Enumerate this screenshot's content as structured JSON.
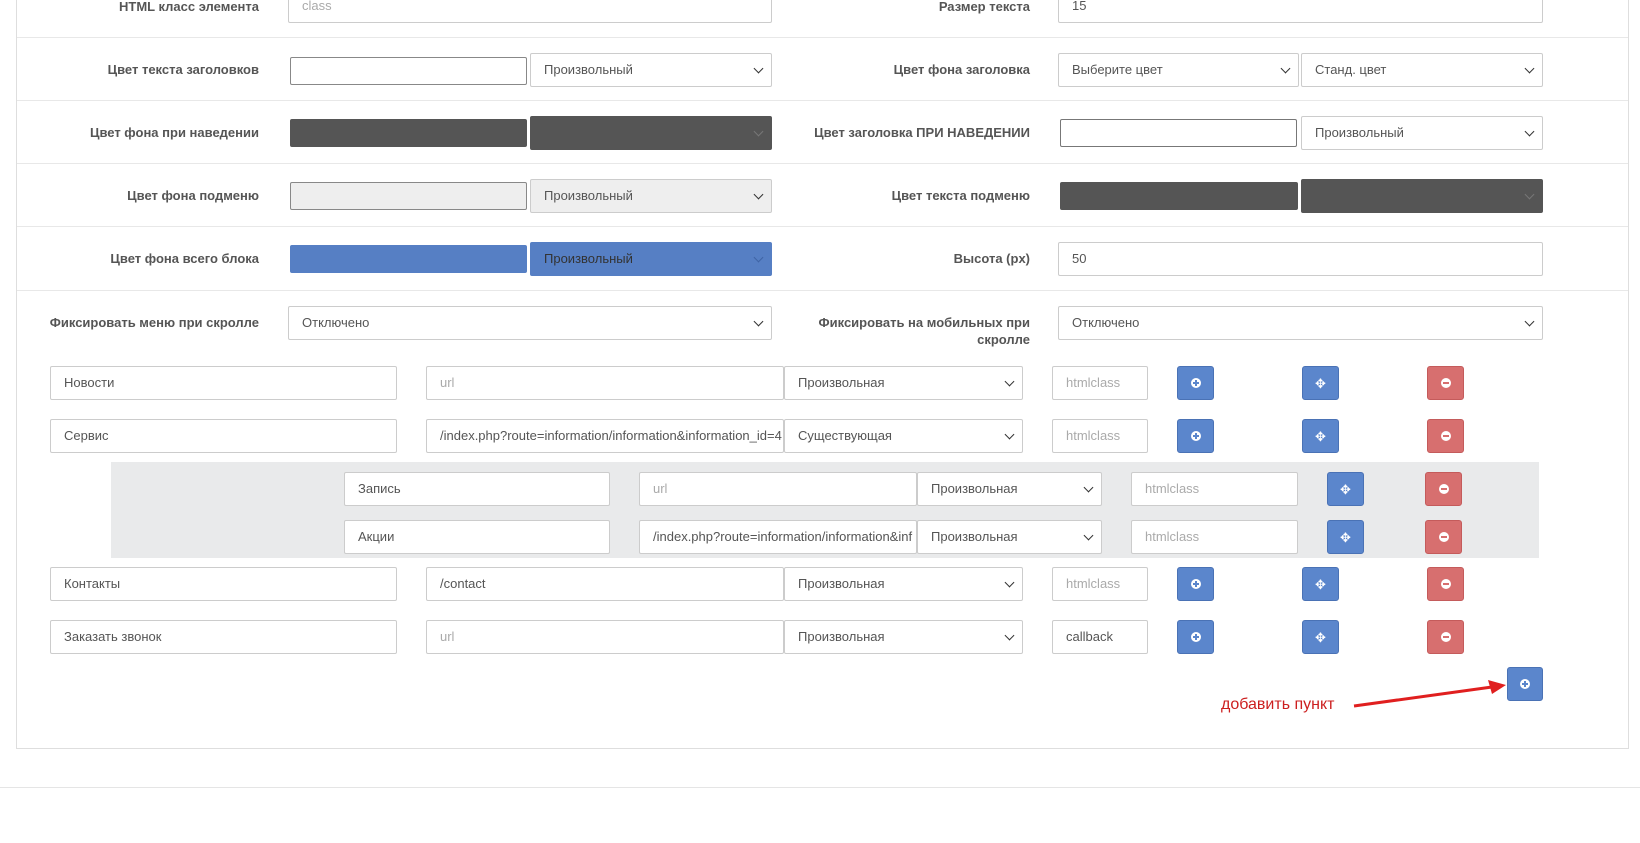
{
  "settings": {
    "html_class_label": "HTML класс элемента",
    "html_class_placeholder": "class",
    "text_size_label": "Размер текста",
    "text_size_value": "15",
    "title_text_color_label": "Цвет текста заголовков",
    "title_text_color_select": "Произвольный",
    "title_bg_color_label": "Цвет фона заголовка",
    "title_bg_color_select": "Выберите цвет",
    "title_bg_std_select": "Станд. цвет",
    "hover_bg_color_label": "Цвет фона при наведении",
    "hover_title_color_label": "Цвет заголовка ПРИ НАВЕДЕНИИ",
    "hover_title_color_select": "Произвольный",
    "submenu_bg_label": "Цвет фона подменю",
    "submenu_bg_select": "Произвольный",
    "submenu_text_label": "Цвет текста подменю",
    "block_bg_label": "Цвет фона всего блока",
    "block_bg_select": "Произвольный",
    "height_label": "Высота (px)",
    "height_value": "50",
    "fix_scroll_label": "Фиксировать меню при скролле",
    "fix_scroll_select": "Отключено",
    "fix_mobile_label": "Фиксировать на мобильных при скролле",
    "fix_mobile_select": "Отключено"
  },
  "colors": {
    "hover_bg": "#555555",
    "submenu_bg": "#eeeeee",
    "submenu_text": "#555555",
    "block_bg": "#567fc4",
    "button_blue": "#5b86cc",
    "button_red": "#d76f6f",
    "annotation": "#cc1f1f"
  },
  "menu_items": [
    {
      "name": "Новости",
      "url": "",
      "url_placeholder": "url",
      "type": "Произвольная",
      "class": "",
      "class_placeholder": "htmlclass"
    },
    {
      "name": "Сервис",
      "url": "/index.php?route=information/information&information_id=4",
      "url_placeholder": "url",
      "type": "Существующая",
      "class": "",
      "class_placeholder": "htmlclass"
    },
    {
      "name": "Контакты",
      "url": "/contact",
      "url_placeholder": "url",
      "type": "Произвольная",
      "class": "",
      "class_placeholder": "htmlclass"
    },
    {
      "name": "Заказать звонок",
      "url": "",
      "url_placeholder": "url",
      "type": "Произвольная",
      "class": "callback",
      "class_placeholder": "htmlclass"
    }
  ],
  "sub_items": [
    {
      "name": "Запись",
      "url": "",
      "url_placeholder": "url",
      "type": "Произвольная",
      "class": "",
      "class_placeholder": "htmlclass"
    },
    {
      "name": "Акции",
      "url": "/index.php?route=information/information&inf",
      "url_placeholder": "url",
      "type": "Произвольная",
      "class": "",
      "class_placeholder": "htmlclass"
    }
  ],
  "icons": {
    "add": "plus-circle-icon",
    "move": "arrows-move-icon",
    "remove": "minus-circle-icon",
    "select": "chevron-down-icon"
  },
  "annotation_text": "добавить пункт"
}
